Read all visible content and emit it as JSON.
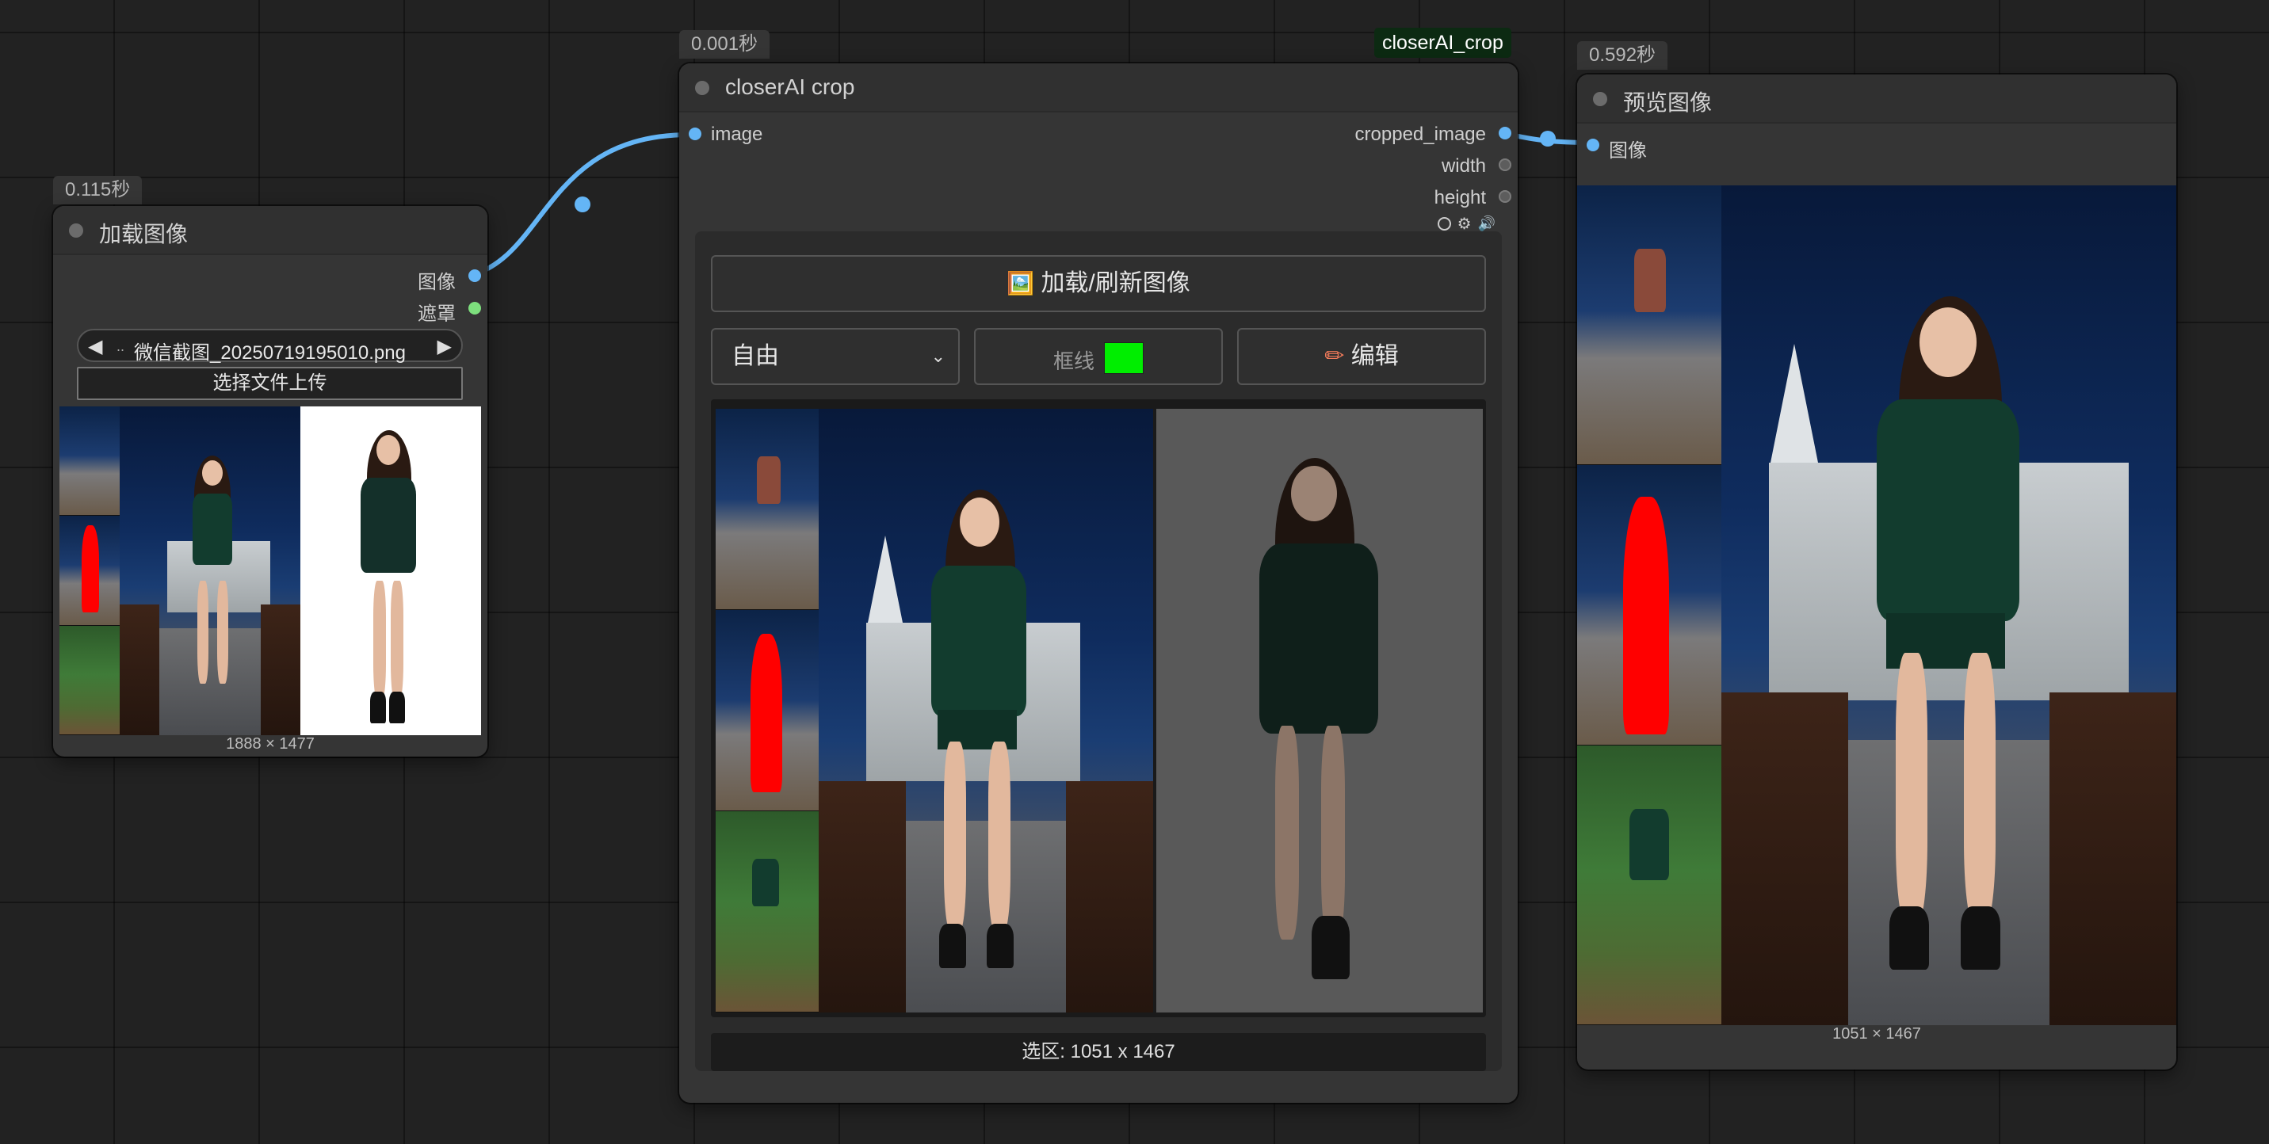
{
  "load_node": {
    "timing": "0.115秒",
    "title": "加载图像",
    "outputs": [
      "图像",
      "遮罩"
    ],
    "filename": "微信截图_20250719195010.png",
    "filename_prefix": "..",
    "upload_button": "选择文件上传",
    "image_size": "1888 × 1477"
  },
  "crop_node": {
    "timing": "0.001秒",
    "badge": "closerAI_crop",
    "title": "closerAI crop",
    "input": "image",
    "outputs": [
      "cropped_image",
      "width",
      "height"
    ],
    "load_button": "加载/刷新图像",
    "mode_select": "自由",
    "border_label": "框线",
    "border_color": "#00ee00",
    "edit_button": "编辑",
    "selection": "选区: 1051 x 1467"
  },
  "preview_node": {
    "timing": "0.592秒",
    "title": "预览图像",
    "input": "图像",
    "image_size": "1051 × 1467"
  },
  "colors": {
    "canvas": "#222222",
    "node": "#353535",
    "wire": "#64b5f6",
    "image_slot": "#64b5f6",
    "mask_slot": "#7ddf7d"
  },
  "icons": [
    "image-emoji-icon",
    "pencil-icon",
    "arrow-left-icon",
    "arrow-right-icon",
    "chevron-down-icon",
    "circle-icon",
    "gear-icon",
    "speaker-icon"
  ]
}
